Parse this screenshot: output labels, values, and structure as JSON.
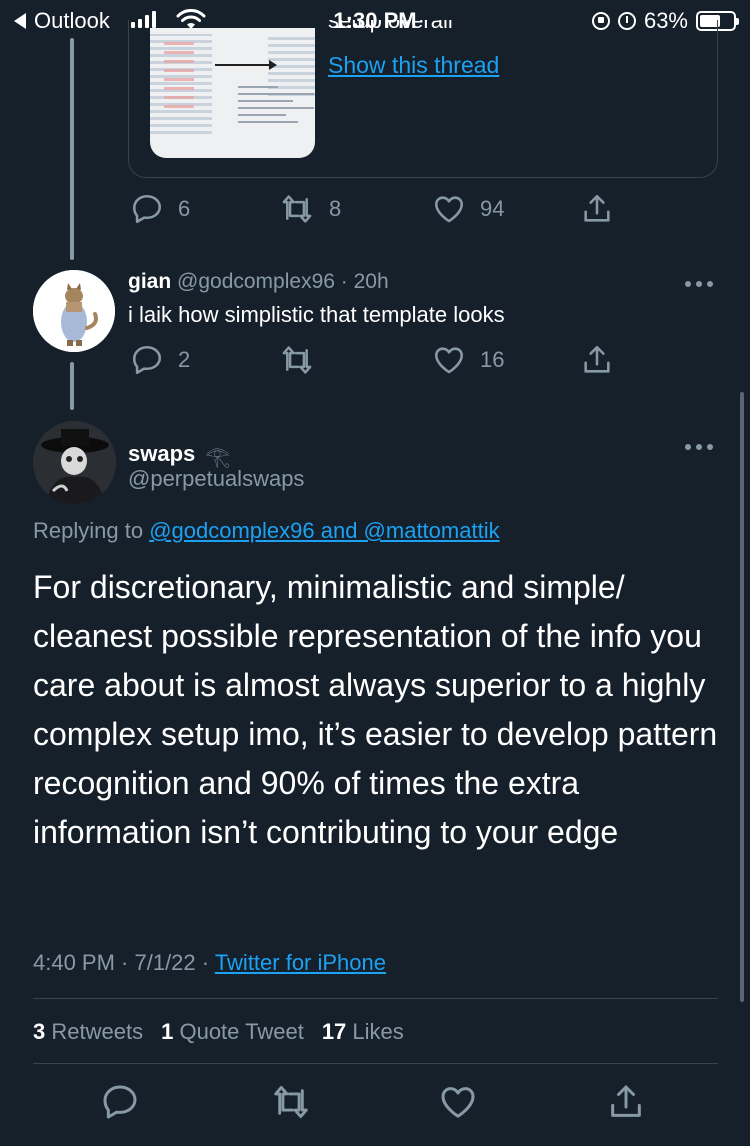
{
  "status_bar": {
    "back_app": "Outlook",
    "time": "1:30 PM",
    "battery": "63%",
    "battery_level": 0.63
  },
  "quoted": {
    "cut_text": "setup overall",
    "show_thread": "Show this thread",
    "actions": {
      "replies": "6",
      "retweets": "8",
      "likes": "94"
    }
  },
  "reply_tweet": {
    "name": "gian",
    "handle": "@godcomplex96",
    "time": "· 20h",
    "text": "i laik how simplistic that template looks",
    "actions": {
      "replies": "2",
      "retweets": "",
      "likes": "16"
    }
  },
  "main_tweet": {
    "name": "swaps",
    "name_emoji": "𓂀",
    "handle": "@perpetualswaps",
    "replying_prefix": "Replying to ",
    "replying_to": "@godcomplex96 and @mattomattik",
    "text": "For discretionary, minimalistic and simple/ cleanest possible representation of the info you care about is almost always superior to a highly complex setup imo, it’s easier to develop pattern recognition and 90% of times the extra information isn’t contributing to your edge",
    "timestamp": "4:40 PM · 7/1/22 · ",
    "source": "Twitter for iPhone",
    "stats": {
      "retweets_count": "3",
      "retweets_label": "Retweets",
      "quotes_count": "1",
      "quotes_label": "Quote Tweet",
      "likes_count": "17",
      "likes_label": "Likes"
    }
  },
  "colors": {
    "background": "#15202b",
    "muted": "#8899a6",
    "link": "#1da1f2",
    "divider": "#38444d"
  }
}
